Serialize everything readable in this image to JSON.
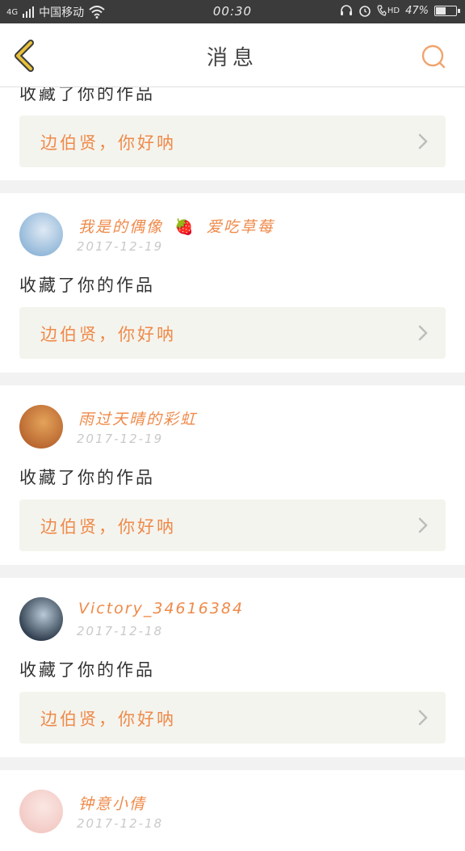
{
  "status_bar": {
    "network": "4G",
    "carrier": "中国移动",
    "time": "00:30",
    "hd": "HD",
    "battery": "47%",
    "battery_level": 0.47
  },
  "header": {
    "title": "消息"
  },
  "first_card": {
    "action": "收藏了你的作品",
    "quote": "边伯贤，你好呐"
  },
  "messages": [
    {
      "name": "我是的偶像",
      "emoji": "🍓",
      "name_suffix": "爱吃草莓",
      "date": "2017-12-19",
      "action": "收藏了你的作品",
      "quote": "边伯贤，你好呐",
      "avatar_colors": [
        "#8fb6d8",
        "#dfe9f4"
      ]
    },
    {
      "name": "雨过天晴的彩虹",
      "emoji": "",
      "name_suffix": "",
      "date": "2017-12-19",
      "action": "收藏了你的作品",
      "quote": "边伯贤，你好呐",
      "avatar_colors": [
        "#b8652f",
        "#e4a35a"
      ]
    },
    {
      "name": "Victory_34616384",
      "emoji": "",
      "name_suffix": "",
      "date": "2017-12-18",
      "action": "收藏了你的作品",
      "quote": "边伯贤，你好呐",
      "avatar_colors": [
        "#2b3a4a",
        "#b9c9d6"
      ]
    }
  ],
  "last_card": {
    "name": "钟意小倩",
    "date": "2017-12-18",
    "avatar_colors": [
      "#f2c9c4",
      "#fbe7e3"
    ]
  },
  "colors": {
    "accent": "#ef8a4a",
    "back_icon": "#e8c13a",
    "search_icon": "#f0a46e"
  }
}
